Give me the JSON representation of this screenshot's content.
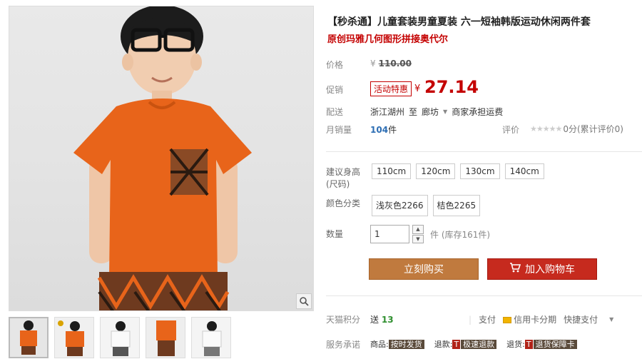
{
  "product": {
    "title": "【秒杀通】儿童套装男童夏装 六一短袖韩版运动休闲两件套",
    "subtitle": "原创玛雅几何图形拼接奥代尔"
  },
  "price": {
    "label": "价格",
    "currency": "¥",
    "original": "110.00"
  },
  "promo": {
    "label": "促销",
    "badge": "活动特惠",
    "currency": "¥",
    "price": "27.14"
  },
  "shipping": {
    "label": "配送",
    "from": "浙江湖州",
    "to_word": "至",
    "dest": "廊坊",
    "fee": "商家承担运费"
  },
  "sales": {
    "label": "月销量",
    "count": "104",
    "unit": "件"
  },
  "rating": {
    "label": "评价",
    "stars": "★★★★★",
    "text": "0分(累计评价0)"
  },
  "size": {
    "label": "建议身高(尺码)",
    "options": [
      "110cm",
      "120cm",
      "130cm",
      "140cm"
    ]
  },
  "color": {
    "label": "颜色分类",
    "options": [
      "浅灰色2266",
      "桔色2265"
    ]
  },
  "quantity": {
    "label": "数量",
    "value": "1",
    "unit": "件",
    "stock": "(库存161件)"
  },
  "buttons": {
    "buy_now": "立刻购买",
    "add_cart": "加入购物车"
  },
  "points": {
    "label": "天猫积分",
    "prefix": "送",
    "value": "13"
  },
  "payment": {
    "label": "支付",
    "credit": "信用卡分期",
    "express": "快捷支付"
  },
  "service": {
    "label": "服务承诺",
    "item1_prefix": "商品:",
    "item1_tag": "按时发货",
    "item2_prefix": "退款:",
    "item2_badge": "T",
    "item2_tag": "极速退款",
    "item3_prefix": "退货:",
    "item3_badge": "T",
    "item3_tag": "退货保障卡"
  },
  "colors": {
    "accent_red": "#c40000",
    "buy_now_bg": "#c07a3e",
    "add_cart_bg": "#c62a1e"
  }
}
